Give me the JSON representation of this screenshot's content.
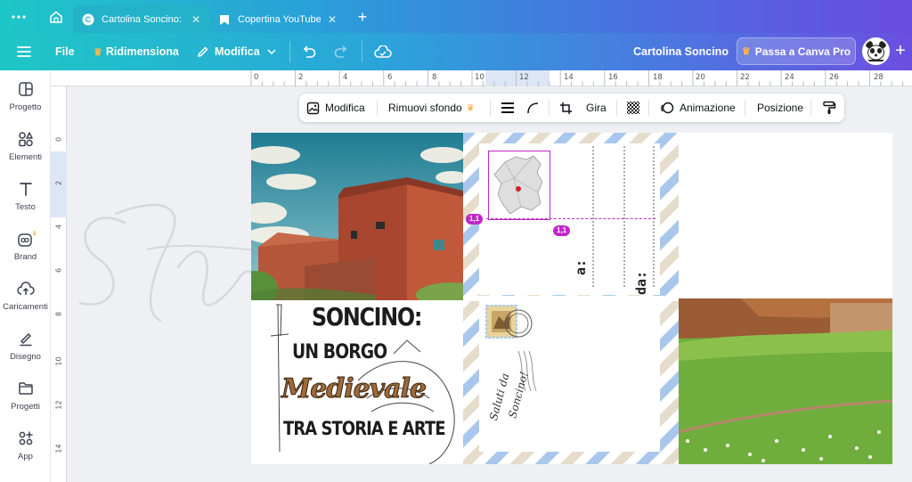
{
  "browser": {
    "tabs": [
      {
        "title": "Cartolina Soncino: ..."
      },
      {
        "title": "Copertina YouTube..."
      }
    ],
    "new_tab": "+"
  },
  "header": {
    "file": "File",
    "resize": "Ridimensiona",
    "edit": "Modifica",
    "doc_title": "Cartolina Soncino",
    "pro_button": "Passa a Canva Pro",
    "plus": "+"
  },
  "sidebar": {
    "items": [
      {
        "label": "Progetto",
        "icon": "layout-icon"
      },
      {
        "label": "Elementi",
        "icon": "shapes-icon"
      },
      {
        "label": "Testo",
        "icon": "text-icon"
      },
      {
        "label": "Brand",
        "icon": "brand-icon"
      },
      {
        "label": "Caricamenti",
        "icon": "upload-icon"
      },
      {
        "label": "Disegno",
        "icon": "draw-icon"
      },
      {
        "label": "Progetti",
        "icon": "folder-icon"
      },
      {
        "label": "App",
        "icon": "apps-icon"
      }
    ]
  },
  "ruler": {
    "top": [
      "0",
      "2",
      "4",
      "6",
      "8",
      "10",
      "12",
      "14",
      "16",
      "18",
      "20",
      "22",
      "24",
      "26",
      "28"
    ],
    "left": [
      "0",
      "2",
      "4",
      "6",
      "8",
      "10",
      "12",
      "14"
    ]
  },
  "toolbar": {
    "edit": "Modifica",
    "remove_bg": "Rimuovi sfondo",
    "flip": "Gira",
    "animation": "Animazione",
    "position": "Posizione"
  },
  "postcard": {
    "title_line1": "SONCINO:",
    "title_line2": "UN BORGO",
    "title_line3": "Medievale",
    "title_line4": "TRA STORIA E ARTE",
    "greeting_line1": "Saluti da",
    "greeting_line2": "Soncino!",
    "address_to": "a:",
    "address_from": "da:",
    "handle_left": "1,1",
    "handle_bottom": "1,1",
    "watermark": "Sfumatura"
  },
  "colors": {
    "accent": "#8b3dff",
    "selection": "#c026c5",
    "airmail_blue": "#a9c7ec",
    "airmail_tan": "#e6dccb"
  }
}
